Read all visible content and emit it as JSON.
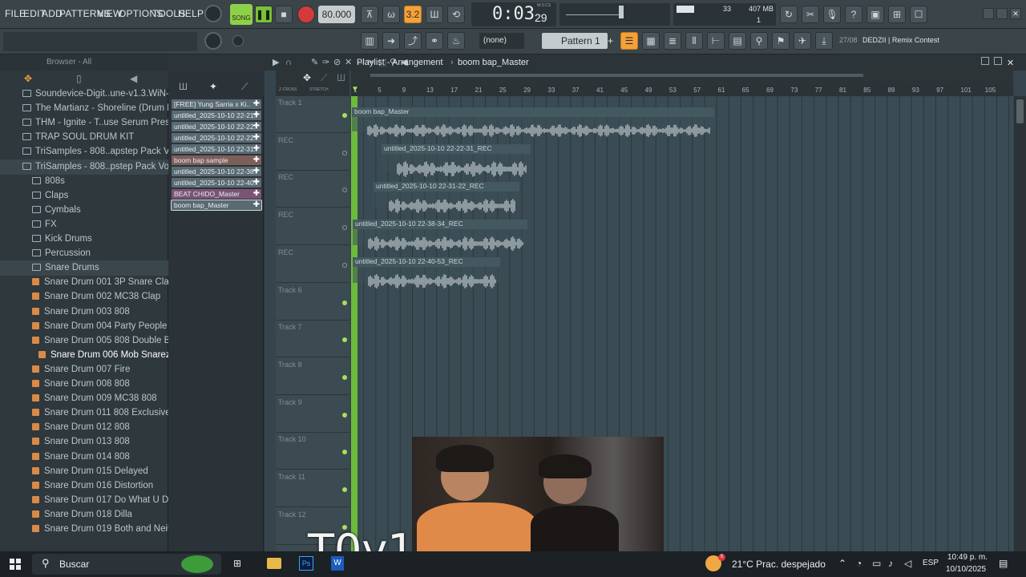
{
  "menubar": {
    "items": [
      "FILE",
      "EDIT",
      "ADD",
      "PATTERNS",
      "VIEW",
      "OPTIONS",
      "TOOLS",
      "HELP"
    ],
    "song_label": "SONG",
    "tempo": "80.000",
    "time": "0:03",
    "time_ms": "29",
    "time_unit": "M:S:CS",
    "cpu": "33",
    "ram": "407 MB",
    "poly": "1"
  },
  "toolbar2": {
    "pattern_none": "(none)",
    "pattern": "Pattern 1",
    "news": "27/08",
    "news_text": "DEDZII | Remix Contest"
  },
  "browser": {
    "title": "Browser - All",
    "items": [
      {
        "label": "Soundevice-Digit..une-v1.3.WiN-TCD",
        "type": "folder",
        "indent": 0
      },
      {
        "label": "The Martianz - Shoreline (Drum Kit)",
        "type": "folder",
        "indent": 0
      },
      {
        "label": "THM - Ignite - T..use Serum Presets",
        "type": "folder",
        "indent": 0
      },
      {
        "label": "TRAP SOUL DRUM KIT",
        "type": "folder",
        "indent": 0
      },
      {
        "label": "TriSamples - 808..apstep Pack Vol 1",
        "type": "folder",
        "indent": 0
      },
      {
        "label": "TriSamples - 808..pstep Pack Vol 2",
        "type": "folder",
        "indent": 0
      },
      {
        "label": "808s",
        "type": "folder",
        "indent": 1
      },
      {
        "label": "Claps",
        "type": "folder",
        "indent": 1
      },
      {
        "label": "Cymbals",
        "type": "folder",
        "indent": 1
      },
      {
        "label": "FX",
        "type": "folder",
        "indent": 1
      },
      {
        "label": "Kick Drums",
        "type": "folder",
        "indent": 1
      },
      {
        "label": "Percussion",
        "type": "folder",
        "indent": 1
      },
      {
        "label": "Snare Drums",
        "type": "folder",
        "indent": 1
      },
      {
        "label": "Snare Drum 001 3P Snare Clap",
        "type": "file",
        "indent": 1
      },
      {
        "label": "Snare Drum 002 MC38 Clap",
        "type": "file",
        "indent": 1
      },
      {
        "label": "Snare Drum 003 808",
        "type": "file",
        "indent": 1
      },
      {
        "label": "Snare Drum 004 Party People",
        "type": "file",
        "indent": 1
      },
      {
        "label": "Snare Drum 005 808 Double B1",
        "type": "file",
        "indent": 1
      },
      {
        "label": "Snare Drum 006 Mob Snarez",
        "type": "file",
        "indent": 1
      },
      {
        "label": "Snare Drum 007 Fire",
        "type": "file",
        "indent": 1
      },
      {
        "label": "Snare Drum 008 808",
        "type": "file",
        "indent": 1
      },
      {
        "label": "Snare Drum 009 MC38 808",
        "type": "file",
        "indent": 1
      },
      {
        "label": "Snare Drum 011 808 Exclusive",
        "type": "file",
        "indent": 1
      },
      {
        "label": "Snare Drum 012 808",
        "type": "file",
        "indent": 1
      },
      {
        "label": "Snare Drum 013 808",
        "type": "file",
        "indent": 1
      },
      {
        "label": "Snare Drum 014 808",
        "type": "file",
        "indent": 1
      },
      {
        "label": "Snare Drum 015 Delayed",
        "type": "file",
        "indent": 1
      },
      {
        "label": "Snare Drum 016 Distortion",
        "type": "file",
        "indent": 1
      },
      {
        "label": "Snare Drum 017 Do What U Do",
        "type": "file",
        "indent": 1
      },
      {
        "label": "Snare Drum 018 Dilla",
        "type": "file",
        "indent": 1
      },
      {
        "label": "Snare Drum 019 Both and Neither",
        "type": "file",
        "indent": 1
      }
    ]
  },
  "picker": {
    "clips": [
      "[FREE] Yung Sarria x Ki..",
      "untitled_2025-10-10 22-21..",
      "untitled_2025-10-10 22-22..",
      "untitled_2025-10-10 22-22..",
      "untitled_2025-10-10 22-31..",
      "boom bap sample",
      "untitled_2025-10-10 22-38..",
      "untitled_2025-10-10 22-40..",
      "BEAT CHIDO_Master",
      "boom bap_Master"
    ]
  },
  "playlist": {
    "title": "Playlist - Arrangement",
    "crumb": "boom bap_Master",
    "zcross": "Z-CROSS",
    "stretch": "STRETCH",
    "ruler": [
      "1",
      "5",
      "9",
      "13",
      "17",
      "21",
      "25",
      "29",
      "33",
      "37",
      "41",
      "45",
      "49",
      "53",
      "57",
      "61",
      "65",
      "69",
      "73",
      "77",
      "81",
      "85",
      "89",
      "93",
      "97",
      "101",
      "105"
    ],
    "tracks": [
      "Track 1",
      "REC",
      "REC",
      "REC",
      "REC",
      "Track 6",
      "Track 7",
      "Track 8",
      "Track 9",
      "Track 10",
      "Track 11",
      "Track 12"
    ],
    "clips": [
      {
        "label": "boom bap_Master"
      },
      {
        "label": "untitled_2025-10-10 22-22-31_REC"
      },
      {
        "label": "untitled_2025-10-10 22-31-22_REC"
      },
      {
        "label": "untitled_2025-10-10 22-38-34_REC"
      },
      {
        "label": "untitled_2025-10-10 22-40-53_REC"
      }
    ]
  },
  "overlay": {
    "text": "T0v1"
  },
  "taskbar": {
    "search": "Buscar",
    "weather": "21°C  Prac. despejado",
    "lang": "ESP",
    "time": "10:49 p. m.",
    "date": "10/10/2025",
    "weather_badge": "5"
  }
}
